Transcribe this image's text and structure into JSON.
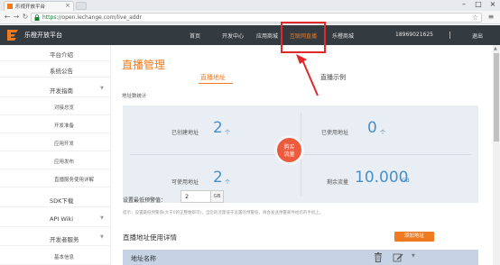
{
  "browser": {
    "tab_title": "乐视开放平台",
    "url_scheme": "https://",
    "url_rest": "open.lechange.com/live_addr"
  },
  "header": {
    "logo_text": "乐橙开放平台",
    "nav": [
      "首页",
      "开发中心",
      "应用商城",
      "互联网直播",
      "乐橙商城"
    ],
    "active_nav": "互联网直播",
    "phone": "18969021625",
    "separator": "|",
    "logout": "退出"
  },
  "sidebar": {
    "items": [
      {
        "label": "平台介绍",
        "sub": false,
        "caret": false
      },
      {
        "label": "系统公告",
        "sub": false,
        "caret": false
      },
      {
        "label": "开发指南",
        "sub": false,
        "caret": true
      },
      {
        "label": "对接总览",
        "sub": true,
        "caret": false
      },
      {
        "label": "开发准备",
        "sub": true,
        "caret": false
      },
      {
        "label": "应用开发",
        "sub": true,
        "caret": false
      },
      {
        "label": "应用发布",
        "sub": true,
        "caret": false
      },
      {
        "label": "直播服务使用详解",
        "sub": true,
        "caret": false
      },
      {
        "label": "SDK下载",
        "sub": false,
        "caret": false
      },
      {
        "label": "API Wiki",
        "sub": false,
        "caret": true
      },
      {
        "label": "开发者服务",
        "sub": false,
        "caret": true
      },
      {
        "label": "基本信息",
        "sub": true,
        "caret": false
      }
    ]
  },
  "main": {
    "title": "直播管理",
    "tab_address": "直播地址",
    "tab_demo": "直播示例",
    "stats_label": "地址数统计",
    "stats": {
      "created_label": "已创建地址",
      "created_value": "2",
      "created_unit": "个",
      "used_label": "已使用地址",
      "used_value": "0",
      "used_unit": "个",
      "available_label": "可使用地址",
      "available_value": "2",
      "available_unit": "个",
      "traffic_label": "剩余流量",
      "traffic_value": "10.000",
      "traffic_unit": "GB"
    },
    "buy_line1": "购买",
    "buy_line2": "流量",
    "warn_label": "设置最低预警值：",
    "warn_value": "2",
    "warn_unit": "GB",
    "hint": "提示：设置最低预警值(大于0的正整数即可)，当您的流量低于设置的预警值，将会发送预警邮件给您的手机上。",
    "detail_title": "直播地址使用详情",
    "add_button": "添加地址",
    "table_header_name": "地址名称"
  },
  "colors": {
    "accent": "#f07a1f",
    "header_bg": "#333a40",
    "stat_blue": "#4a90c8",
    "buy_red": "#ee5a3e",
    "annotation_red": "#e0292b"
  }
}
